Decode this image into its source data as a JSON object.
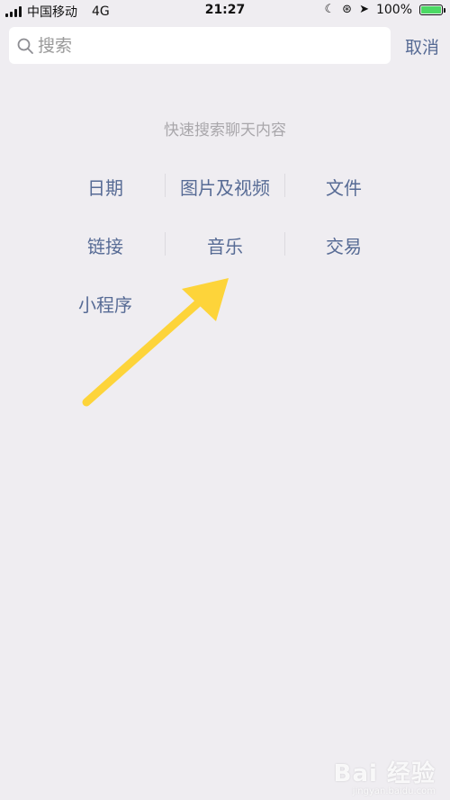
{
  "status_bar": {
    "carrier": "中国移动",
    "network": "4G",
    "time": "21:27",
    "battery_percent": "100%",
    "icons": [
      "signal-icon",
      "moon-icon",
      "rotation-lock-icon",
      "location-icon",
      "battery-icon"
    ]
  },
  "search": {
    "placeholder": "搜索",
    "cancel_label": "取消"
  },
  "hint": "快速搜索聊天内容",
  "categories": [
    {
      "label": "日期"
    },
    {
      "label": "图片及视频"
    },
    {
      "label": "文件"
    },
    {
      "label": "链接"
    },
    {
      "label": "音乐"
    },
    {
      "label": "交易"
    },
    {
      "label": "小程序"
    }
  ],
  "colors": {
    "background": "#efedf1",
    "link": "#576b95",
    "hint": "#a9a7ab",
    "arrow": "#fdd43a",
    "battery": "#4cd964"
  },
  "watermark": {
    "logo": "Bai 经验",
    "url": "jingyan.baidu.com"
  }
}
